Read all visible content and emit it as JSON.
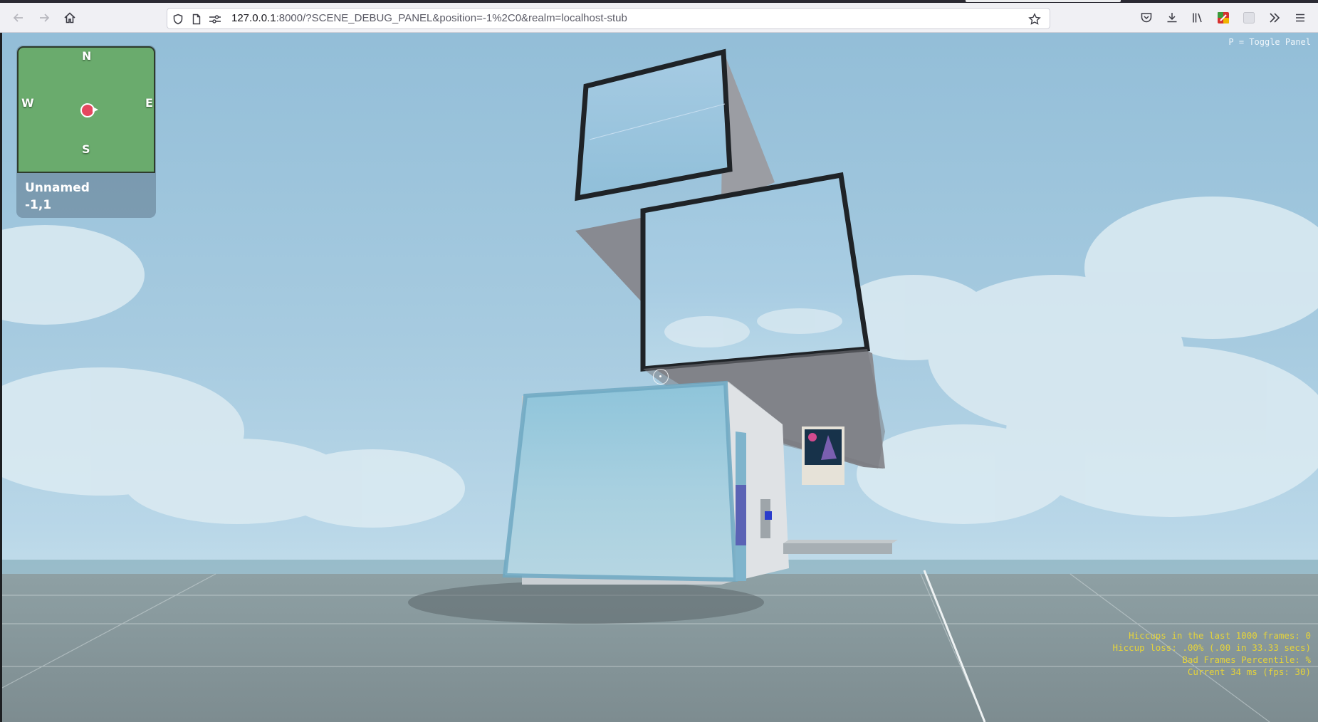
{
  "browser": {
    "url_host": "127.0.0.1",
    "url_rest": ":8000/?SCENE_DEBUG_PANEL&position=-1%2C0&realm=localhost-stub",
    "icons": [
      "back-icon",
      "forward-icon",
      "home-icon",
      "shield-icon",
      "page-icon",
      "permissions-icon",
      "bookmark-star-icon",
      "pocket-icon",
      "download-icon",
      "library-icon",
      "extension-icon",
      "extension-icon-2",
      "overflow-chevrons-icon",
      "menu-icon"
    ]
  },
  "minimap": {
    "north": "N",
    "south": "S",
    "east": "E",
    "west": "W",
    "scene_name": "Unnamed",
    "coords": "-1,1",
    "map_color": "#6aab6d",
    "player_color": "#e5475f"
  },
  "hint": {
    "toggle_panel": "P = Toggle Panel"
  },
  "perf": {
    "hiccups": "Hiccups in the last 1000 frames: 0",
    "hiccup_loss": "Hiccup loss: .00% (.00 in 33.33 secs)",
    "bad_frames": "Bad Frames Percentile: %",
    "current": "Current 34 ms (fps: 30)",
    "text_color": "#e5d33a"
  }
}
